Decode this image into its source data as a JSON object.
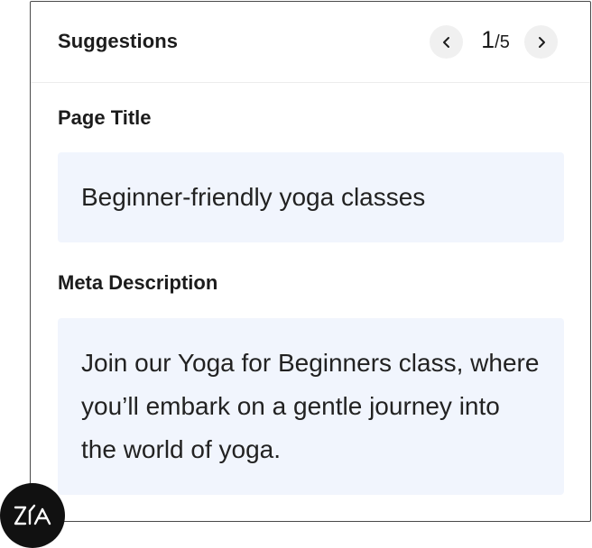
{
  "panel": {
    "title": "Suggestions",
    "pager": {
      "current": "1",
      "separator": "/",
      "total": "5"
    },
    "prev_icon": "chevron-left-icon",
    "next_icon": "chevron-right-icon"
  },
  "page_title": {
    "label": "Page Title",
    "value": "Beginner-friendly yoga classes"
  },
  "meta_description": {
    "label": "Meta Description",
    "value": "Join our Yoga for Beginners class, where you’ll embark on a gentle journey into the world of yoga."
  },
  "assistant": {
    "logo_text": "Zia",
    "icon": "zia-logo-icon"
  },
  "colors": {
    "card_border": "#4a4a4a",
    "box_background": "#f1f5fd",
    "nav_button_background": "#f0f0f0",
    "badge_background": "#111111"
  }
}
